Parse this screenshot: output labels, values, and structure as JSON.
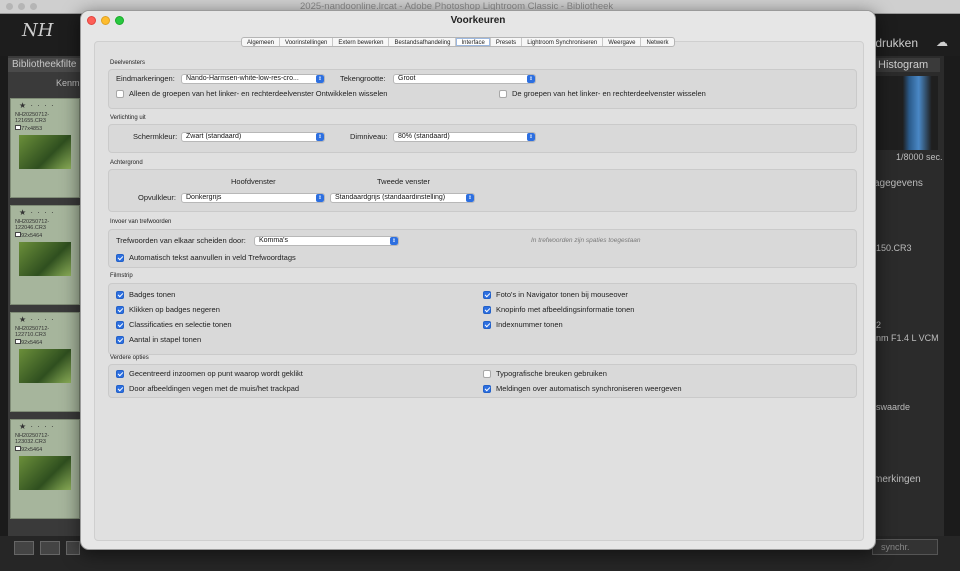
{
  "background_app": {
    "window_title": "2025-nandoonline.lrcat - Adobe Photoshop Lightroom Classic - Bibliotheek",
    "module": "fdrukken",
    "left_panel_header": "Bibliotheekfilte",
    "left_panel_button": "Kenm",
    "thumbnails": [
      {
        "name": "NH20250712-121655.CR3",
        "meta": "7277x4853"
      },
      {
        "name": "NH20250712-122046.CR3",
        "meta": "8192x5464"
      },
      {
        "name": "NH20250712-122710.CR3",
        "meta": "8192x5464"
      },
      {
        "name": "NH20250712-123032.CR3",
        "meta": "8192x5464"
      }
    ],
    "right_panel": {
      "histogram": "Histogram",
      "shutter": "1/8000 sec.",
      "metadata_header": "agegevens",
      "filename": "150.CR3",
      "number": "2",
      "lens": "nm F1.4 L VCM",
      "value_label": "swaarde",
      "comments_header": "merkingen",
      "sync_button": "synchr."
    }
  },
  "dialog": {
    "title": "Voorkeuren",
    "tabs": [
      "Algemeen",
      "Voorinstellingen",
      "Extern bewerken",
      "Bestandsafhandeling",
      "Interface",
      "Presets",
      "Lightroom Synchroniseren",
      "Weergave",
      "Netwerk"
    ],
    "active_tab": "Interface",
    "deelvensters": {
      "title": "Deelvensters",
      "end_marks_label": "Eindmarkeringen:",
      "end_marks_value": "Nando-Harmsen-white-low-res-cro...",
      "font_size_label": "Tekengrootte:",
      "font_size_value": "Groot",
      "solo_left": "Alleen de groepen van het linker- en rechterdeelvenster Ontwikkelen wisselen",
      "solo_right": "De groepen van het linker- en rechterdeelvenster wisselen"
    },
    "verlichting": {
      "title": "Verlichting uit",
      "screen_color_label": "Schermkleur:",
      "screen_color_value": "Zwart (standaard)",
      "dim_label": "Dimniveau:",
      "dim_value": "80% (standaard)"
    },
    "achtergrond": {
      "title": "Achtergrond",
      "main_window": "Hoofdvenster",
      "second_window": "Tweede venster",
      "fill_label": "Opvulkleur:",
      "fill_main_value": "Donkergrijs",
      "fill_second_value": "Standaardgrijs (standaardinstelling)"
    },
    "trefwoorden": {
      "title": "Invoer van trefwoorden",
      "separator_label": "Trefwoorden van elkaar scheiden door:",
      "separator_value": "Komma's",
      "hint": "In trefwoorden zijn spaties toegestaan",
      "autocomplete": "Automatisch tekst aanvullen in veld Trefwoordtags"
    },
    "filmstrip": {
      "title": "Filmstrip",
      "items_left": [
        "Badges tonen",
        "Klikken op badges negeren",
        "Classificaties en selectie tonen",
        "Aantal in stapel tonen"
      ],
      "items_right": [
        "Foto's in Navigator tonen bij mouseover",
        "Knopinfo met afbeeldingsinformatie tonen",
        "Indexnummer tonen"
      ]
    },
    "verdere": {
      "title": "Verdere opties",
      "items_left": [
        "Gecentreerd inzoomen op punt waarop wordt geklikt",
        "Door afbeeldingen vegen met de muis/het trackpad"
      ],
      "items_right": [
        "Typografische breuken gebruiken",
        "Meldingen over automatisch synchroniseren weergeven"
      ]
    }
  },
  "colors": {
    "accent": "#2d6fe0",
    "dialog_bg": "#e6e6e6",
    "app_bg": "#1b1b1b"
  }
}
